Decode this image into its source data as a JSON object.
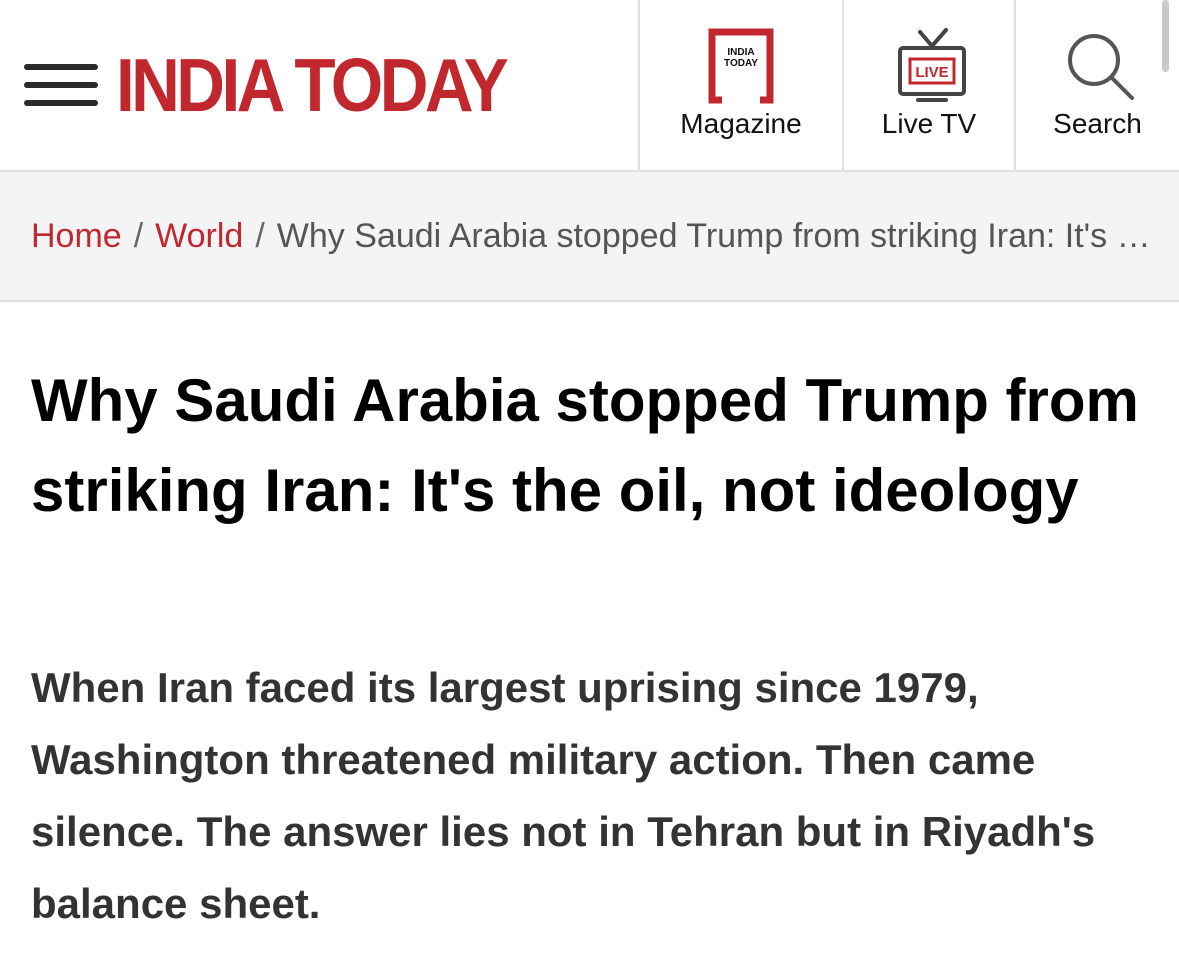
{
  "header": {
    "logo_text": "INDIA TODAY",
    "brand_color": "#c1282d",
    "nav": [
      {
        "label": "Magazine",
        "icon": "magazine-icon",
        "icon_text": "INDIA TODAY"
      },
      {
        "label": "Live TV",
        "icon": "live-tv-icon",
        "icon_text": "LIVE"
      },
      {
        "label": "Search",
        "icon": "search-icon"
      }
    ]
  },
  "breadcrumb": {
    "home": "Home",
    "section": "World",
    "separator": "/",
    "current": "Why Saudi Arabia stopped Trump from striking Iran: It's the oil, not ideology"
  },
  "article": {
    "headline": "Why Saudi Arabia stopped Trump from striking Iran: It's the oil, not ideology",
    "summary": "When Iran faced its largest uprising since 1979, Washington threatened military action. Then came silence. The answer lies not in Tehran but in Riyadh's balance sheet."
  }
}
